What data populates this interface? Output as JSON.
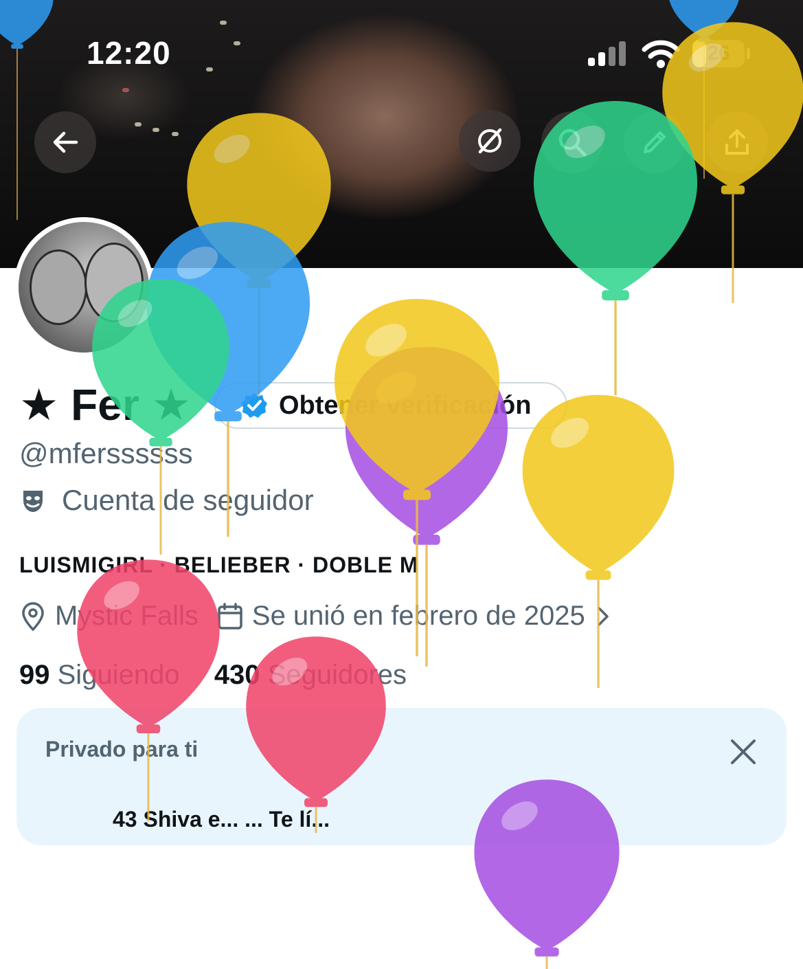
{
  "status_bar": {
    "time": "12:20",
    "battery": "26",
    "battery_level": 0.26
  },
  "header": {
    "back_icon": "back-arrow-icon",
    "grok_icon": "grok-slash-icon",
    "search_icon": "search-icon",
    "edit_icon": "pencil-icon",
    "share_icon": "share-icon"
  },
  "profile": {
    "display_name": "★ Fer ★",
    "verify_button_label": "Obtener verificación",
    "handle": "@mferssssss",
    "account_type": "Cuenta de seguidor",
    "bio": "LUISMIGIRL · BELIEBER · DOBLE M",
    "location": "Mystic Falls",
    "joined": "Se unió en febrero de 2025",
    "following_count": "99",
    "following_label": "Siguiendo",
    "followers_count": "430",
    "followers_label": "Seguidores"
  },
  "private_card": {
    "title": "Privado para ti",
    "preview": "43 Shiva e... ... Te lí..."
  },
  "colors": {
    "accent": "#1d9bf0",
    "secondary_text": "#536471",
    "balloon_yellow": "#f2c81c",
    "balloon_blue": "#2f9df4",
    "balloon_green": "#2fd58e",
    "balloon_red": "#f0436a",
    "balloon_purple": "#a64fe2"
  }
}
